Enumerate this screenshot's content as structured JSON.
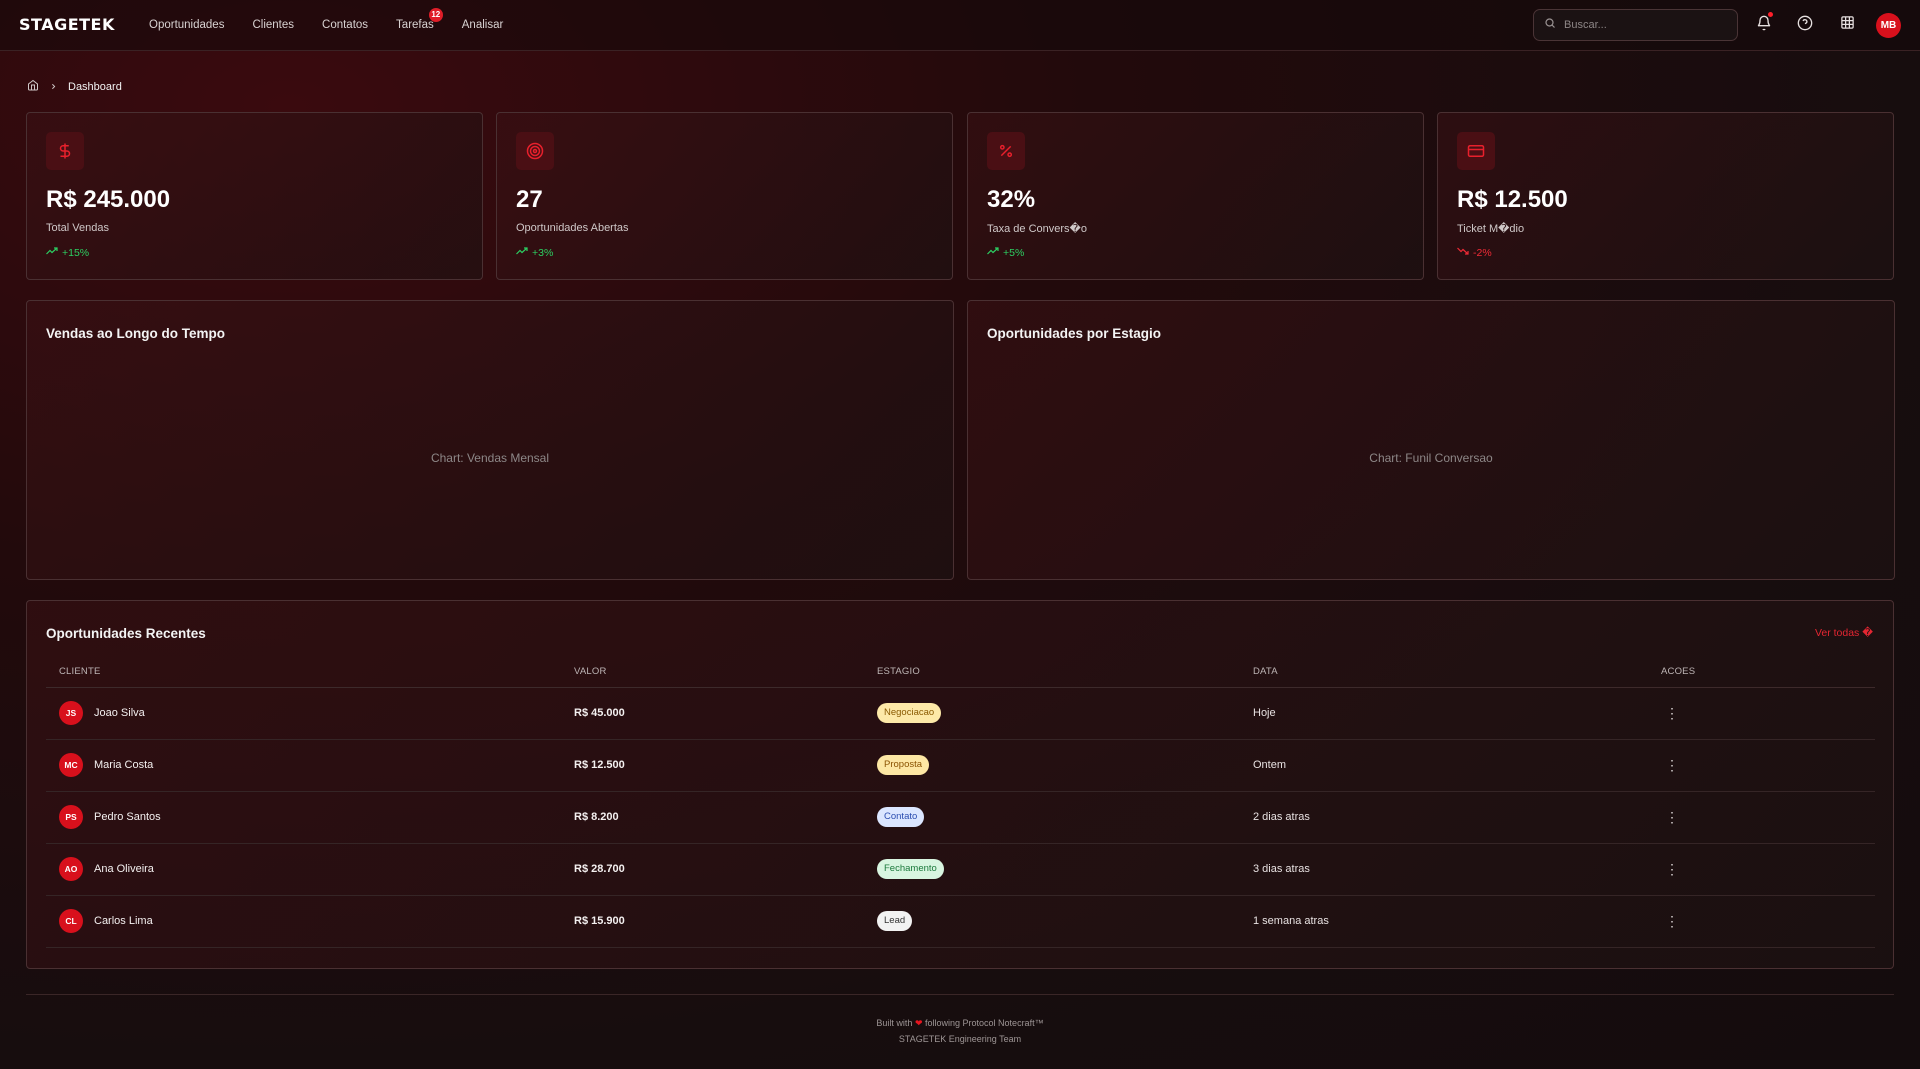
{
  "header": {
    "logo": "STAGETEK",
    "nav": [
      {
        "label": "Oportunidades"
      },
      {
        "label": "Clientes"
      },
      {
        "label": "Contatos"
      },
      {
        "label": "Tarefas",
        "badge": "12"
      },
      {
        "label": "Analisar"
      }
    ],
    "search_placeholder": "Buscar...",
    "avatar_initials": "MB"
  },
  "breadcrumb": {
    "current": "Dashboard"
  },
  "kpis": [
    {
      "icon": "dollar-icon",
      "value": "R$ 245.000",
      "label": "Total Vendas",
      "change": "+15%",
      "trend": "up"
    },
    {
      "icon": "target-icon",
      "value": "27",
      "label": "Oportunidades Abertas",
      "change": "+3%",
      "trend": "up"
    },
    {
      "icon": "percent-icon",
      "value": "32%",
      "label": "Taxa de Convers�o",
      "change": "+5%",
      "trend": "up"
    },
    {
      "icon": "card-icon",
      "value": "R$ 12.500",
      "label": "Ticket M�dio",
      "change": "-2%",
      "trend": "down"
    }
  ],
  "charts": [
    {
      "title": "Vendas ao Longo do Tempo",
      "placeholder": "Chart: Vendas Mensal"
    },
    {
      "title": "Oportunidades por Estagio",
      "placeholder": "Chart: Funil Conversao"
    }
  ],
  "table": {
    "title": "Oportunidades Recentes",
    "view_all": "Ver todas �",
    "columns": [
      "CLIENTE",
      "VALOR",
      "ESTAGIO",
      "DATA",
      "ACOES"
    ],
    "rows": [
      {
        "initials": "JS",
        "client": "Joao Silva",
        "value": "R$ 45.000",
        "stage": "Negociacao",
        "stage_bg": "#fde9a8",
        "stage_fg": "#8a5a00",
        "date": "Hoje"
      },
      {
        "initials": "MC",
        "client": "Maria Costa",
        "value": "R$ 12.500",
        "stage": "Proposta",
        "stage_bg": "#fde7a4",
        "stage_fg": "#8a5200",
        "date": "Ontem"
      },
      {
        "initials": "PS",
        "client": "Pedro Santos",
        "value": "R$ 8.200",
        "stage": "Contato",
        "stage_bg": "#dbe6ff",
        "stage_fg": "#2b4db0",
        "date": "2 dias atras"
      },
      {
        "initials": "AO",
        "client": "Ana Oliveira",
        "value": "R$ 28.700",
        "stage": "Fechamento",
        "stage_bg": "#d8f5e0",
        "stage_fg": "#1c7a3c",
        "date": "3 dias atras"
      },
      {
        "initials": "CL",
        "client": "Carlos Lima",
        "value": "R$ 15.900",
        "stage": "Lead",
        "stage_bg": "#f2f2f2",
        "stage_fg": "#333333",
        "date": "1 semana atras"
      }
    ],
    "actions_glyph": "⋮"
  },
  "footer": {
    "line1_before": "Built with",
    "line1_after": "following Protocol Notecraft™",
    "line2": "STAGETEK Engineering Team"
  },
  "colors": {
    "accent": "#d8101c",
    "up": "#2ccf62",
    "down": "#ef2a36"
  }
}
